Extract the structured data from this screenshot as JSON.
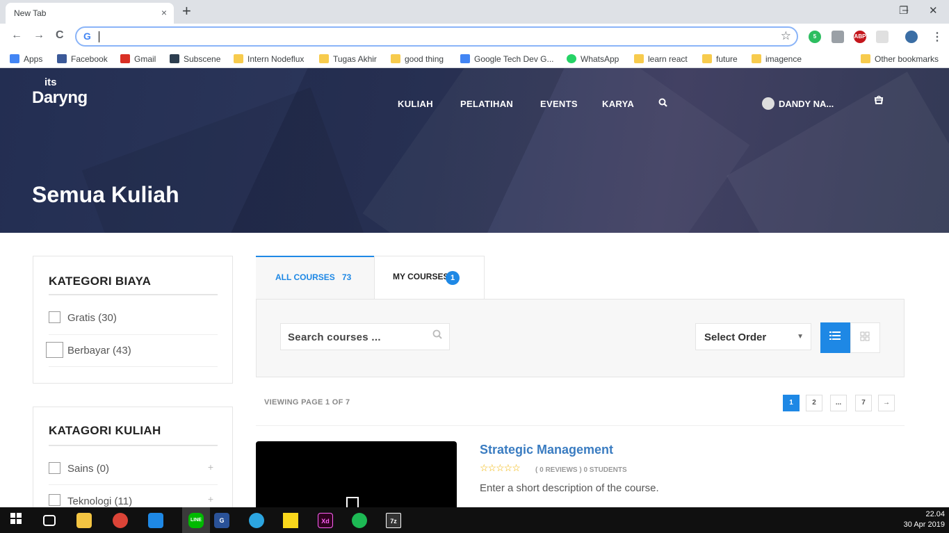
{
  "browser": {
    "tab_title": "New Tab",
    "tab_close": "×",
    "new_tab": "+",
    "window_controls": [
      "–",
      "❐",
      "✕"
    ],
    "nav": {
      "back": "←",
      "forward": "→",
      "reload": "C"
    },
    "omnibox_icon": "G",
    "bookmark_star": "☆",
    "extensions": [
      {
        "icon": "evernote-icon",
        "label": "5",
        "color": "#2dbe60"
      },
      {
        "icon": "shield-icon",
        "label": "",
        "color": "#9aa0a6"
      },
      {
        "icon": "adblock-icon",
        "label": "ABP",
        "color": "#c4161c"
      },
      {
        "icon": "extension-icon",
        "label": "",
        "color": "#e0e0e0"
      },
      {
        "icon": "profile-icon",
        "label": "",
        "color": "#3b6ea5"
      }
    ],
    "menu": "⋮",
    "bookmarks": [
      {
        "label": "Apps",
        "icon": "apps-icon",
        "color": "#4285f4"
      },
      {
        "label": "Facebook",
        "icon": "facebook-icon",
        "color": "#3b5998"
      },
      {
        "label": "Gmail",
        "icon": "gmail-icon",
        "color": "#d93025"
      },
      {
        "label": "Subscene",
        "icon": "subscene-icon",
        "color": "#2d3e50"
      },
      {
        "label": "Intern Nodeflux",
        "icon": "folder-icon",
        "color": "#f7cb4d"
      },
      {
        "label": "Tugas Akhir",
        "icon": "folder-icon",
        "color": "#f7cb4d"
      },
      {
        "label": "good thing",
        "icon": "folder-icon",
        "color": "#f7cb4d"
      },
      {
        "label": "Google Tech Dev G...",
        "icon": "google-icon",
        "color": "#4285f4"
      },
      {
        "label": "WhatsApp",
        "icon": "whatsapp-icon",
        "color": "#25d366"
      },
      {
        "label": "learn react",
        "icon": "folder-icon",
        "color": "#f7cb4d"
      },
      {
        "label": "future",
        "icon": "folder-icon",
        "color": "#f7cb4d"
      },
      {
        "label": "imagence",
        "icon": "folder-icon",
        "color": "#f7cb4d"
      }
    ],
    "other_bookmarks": "Other bookmarks"
  },
  "site": {
    "logo_top": "its",
    "logo_bottom": "Daryng",
    "nav": [
      "KULIAH",
      "PELATIHAN",
      "EVENTS",
      "KARYA"
    ],
    "search_glyph": "🔍",
    "user_name": "DANDY NA...",
    "cart_glyph": "🛍",
    "page_title": "Semua Kuliah"
  },
  "sidebar": {
    "biaya": {
      "title": "KATEGORI BIAYA",
      "items": [
        "Gratis (30)",
        "Berbayar (43)"
      ]
    },
    "kuliah": {
      "title": "KATAGORI KULIAH",
      "items": [
        "Sains (0)",
        "Teknologi (11)"
      ],
      "expand": "+"
    }
  },
  "courses": {
    "tabs": {
      "all_label": "ALL COURSES",
      "all_count": "73",
      "my_label": "MY COURSES",
      "my_count": "1"
    },
    "search_placeholder": "Search courses ...",
    "order_label": "Select Order",
    "order_caret": "▼",
    "viewing": "VIEWING PAGE 1 OF 7",
    "pages": [
      "1",
      "2",
      "...",
      "7",
      "→"
    ],
    "accent": "#1e88e5",
    "first_course": {
      "title": "Strategic Management",
      "stars": "☆☆☆☆☆",
      "rating": 0,
      "meta": "( 0 REVIEWS )  0 STUDENTS",
      "description": "Enter a short description of the course."
    }
  },
  "taskbar": {
    "apps": [
      {
        "icon": "windows-start-icon",
        "label": "",
        "color": "#ffffff"
      },
      {
        "icon": "task-view-icon",
        "label": "",
        "color": "#ffffff"
      },
      {
        "icon": "file-explorer-icon",
        "label": "",
        "color": "#f4c542"
      },
      {
        "icon": "chrome-icon",
        "label": "",
        "color": "#db4437"
      },
      {
        "icon": "vscode-icon",
        "label": "",
        "color": "#1e88e5"
      },
      {
        "icon": "line-icon",
        "label": "LINE",
        "color": "#00b900"
      },
      {
        "icon": "pdf-icon",
        "label": "G",
        "color": "#2a5298"
      },
      {
        "icon": "telegram-icon",
        "label": "",
        "color": "#2ca5e0"
      },
      {
        "icon": "sticky-notes-icon",
        "label": "",
        "color": "#f9d71c"
      },
      {
        "icon": "adobe-xd-icon",
        "label": "Xd",
        "color": "#2e001f"
      },
      {
        "icon": "spotify-icon",
        "label": "",
        "color": "#1db954"
      },
      {
        "icon": "7zip-icon",
        "label": "7z",
        "color": "#333333"
      }
    ],
    "time": "22.04",
    "date": "30 Apr 2019"
  }
}
